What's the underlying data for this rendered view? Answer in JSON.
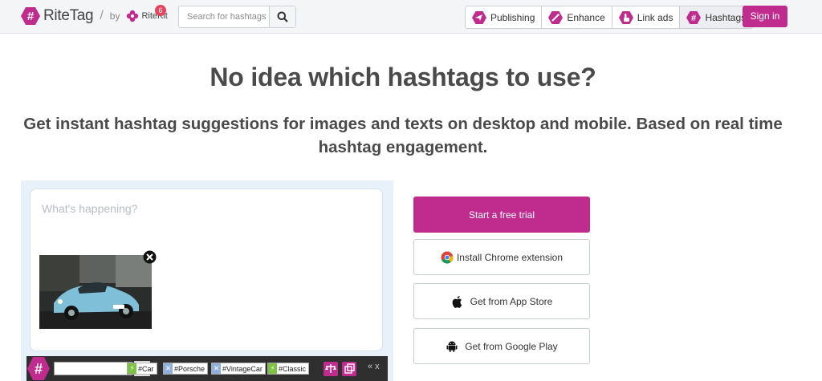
{
  "header": {
    "logo_text": "RiteTag",
    "slash": "/",
    "by_text": "by",
    "ritekit_text": "RiteKit",
    "notification_count": "6",
    "search_placeholder": "Search for hashtags",
    "nav": [
      {
        "label": "Publishing",
        "icon": "paper-plane-icon"
      },
      {
        "label": "Enhance",
        "icon": "magic-wand-icon"
      },
      {
        "label": "Link ads",
        "icon": "pointer-hand-icon"
      },
      {
        "label": "Hashtags",
        "icon": "hashtag-icon"
      }
    ],
    "signin_label": "Sign in"
  },
  "hero": {
    "title": "No idea which hashtags to use?",
    "subtitle": "Get instant hashtag suggestions for images and texts on desktop and mobile. Based on real time hashtag engagement."
  },
  "demo": {
    "composer_placeholder": "What's happening?",
    "image_alt": "vintage-blue-porsche",
    "tags": [
      {
        "label": "#Car",
        "kind": "green"
      },
      {
        "label": "#Porsche",
        "kind": "blue"
      },
      {
        "label": "#VintageCar",
        "kind": "blue"
      },
      {
        "label": "#Classic",
        "kind": "green"
      }
    ],
    "toolbar_more": "« x"
  },
  "actions": {
    "trial": "Start a free trial",
    "chrome": "Install Chrome extension",
    "app_store": "Get from App Store",
    "google_play": "Get from Google Play"
  },
  "colors": {
    "brand": "#c02c8e",
    "tag_green": "#7cc242",
    "tag_blue": "#8fb0de"
  }
}
